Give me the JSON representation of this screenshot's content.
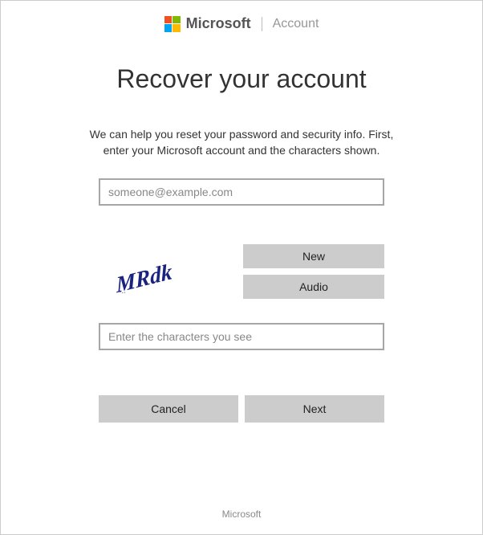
{
  "header": {
    "brand": "Microsoft",
    "section": "Account"
  },
  "main": {
    "title": "Recover your account",
    "instructions": "We can help you reset your password and security info. First, enter your Microsoft account and the characters shown.",
    "email_placeholder": "someone@example.com",
    "captcha_text": "MRdk",
    "captcha_new_label": "New",
    "captcha_audio_label": "Audio",
    "captcha_input_placeholder": "Enter the characters you see",
    "cancel_label": "Cancel",
    "next_label": "Next"
  },
  "footer": {
    "text": "Microsoft"
  }
}
